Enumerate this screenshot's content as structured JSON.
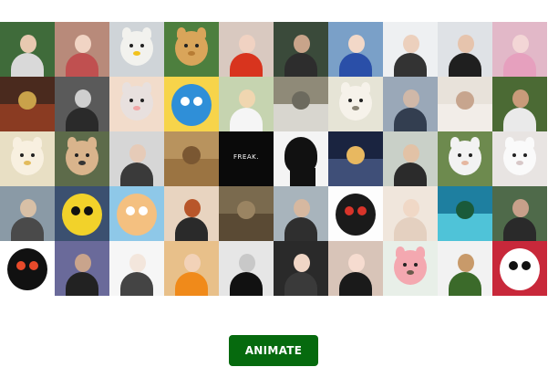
{
  "button": {
    "label": "ANIMATE",
    "color": "#066a0e"
  },
  "tiles": [
    {
      "bg": "#3f6b3a",
      "kind": "person",
      "skin": "#e8c9b0",
      "cloth": "#d9d9d9"
    },
    {
      "bg": "#b88a7a",
      "kind": "person",
      "skin": "#f1d4c4",
      "cloth": "#c05050"
    },
    {
      "bg": "#cfd4d8",
      "kind": "animal",
      "fur": "#f2f2ee",
      "accent": "#f2c21c"
    },
    {
      "bg": "#4d7f3e",
      "kind": "animal",
      "fur": "#d9a55a",
      "accent": "#b77c34"
    },
    {
      "bg": "#d9c9c0",
      "kind": "person",
      "skin": "#f0d2c2",
      "cloth": "#d8341e"
    },
    {
      "bg": "#3a4a3a",
      "kind": "person",
      "skin": "#c8a48a",
      "cloth": "#2d2d2d"
    },
    {
      "bg": "#7aa0c8",
      "kind": "person",
      "skin": "#f2d8c8",
      "cloth": "#2a4fa8"
    },
    {
      "bg": "#eef0f2",
      "kind": "person",
      "skin": "#ecd0bd",
      "cloth": "#333333"
    },
    {
      "bg": "#dfe2e6",
      "kind": "person",
      "skin": "#e6c4ad",
      "cloth": "#1f1f1f"
    },
    {
      "bg": "#e2b8c8",
      "kind": "person",
      "skin": "#f3d6d6",
      "cloth": "#e6a0be"
    },
    {
      "bg": "#4a2a1e",
      "kind": "blob",
      "fur": "#8a3b22",
      "accent": "#c9a24a"
    },
    {
      "bg": "#5a5a5a",
      "kind": "person",
      "skin": "#cfcfcf",
      "cloth": "#2a2a2a"
    },
    {
      "bg": "#f2dccb",
      "kind": "animal",
      "fur": "#e8e0de",
      "accent": "#f0a6a6"
    },
    {
      "bg": "#f7d44a",
      "kind": "cartoon",
      "fur": "#2f8fd8",
      "accent": "#ffffff"
    },
    {
      "bg": "#c6d4b0",
      "kind": "person",
      "skin": "#f0d6b0",
      "cloth": "#f5f5f5"
    },
    {
      "bg": "#8f8a78",
      "kind": "blob",
      "fur": "#d8d6cf",
      "accent": "#6c6a5e"
    },
    {
      "bg": "#e6e4d6",
      "kind": "animal",
      "fur": "#f6f2ea",
      "accent": "#8a8474"
    },
    {
      "bg": "#9aa8b8",
      "kind": "person",
      "skin": "#d0b8a8",
      "cloth": "#333e50"
    },
    {
      "bg": "#e8e2da",
      "kind": "blob",
      "fur": "#f2ede8",
      "accent": "#c7a58e"
    },
    {
      "bg": "#4b6a34",
      "kind": "person",
      "skin": "#c99b7a",
      "cloth": "#eaeaea"
    },
    {
      "bg": "#e8dfc4",
      "kind": "animal",
      "fur": "#f8f0e0",
      "accent": "#e2bb5c"
    },
    {
      "bg": "#5d6b4a",
      "kind": "animal",
      "fur": "#d9b48c",
      "accent": "#343434"
    },
    {
      "bg": "#d6d6d6",
      "kind": "person",
      "skin": "#e6cbb8",
      "cloth": "#3a3a3a"
    },
    {
      "bg": "#b8935e",
      "kind": "blob",
      "fur": "#9b7442",
      "accent": "#7a5732"
    },
    {
      "bg": "#0a0a0a",
      "kind": "text",
      "text": "FREAK.",
      "accent": "#ffffff"
    },
    {
      "bg": "#f4f4f4",
      "kind": "silhouette",
      "fur": "#111111"
    },
    {
      "bg": "#1a2440",
      "kind": "blob",
      "fur": "#3f4f78",
      "accent": "#e8b860"
    },
    {
      "bg": "#c9d0c8",
      "kind": "person",
      "skin": "#e2c2a6",
      "cloth": "#2b2b2b"
    },
    {
      "bg": "#6d8a4e",
      "kind": "animal",
      "fur": "#f2f2f2",
      "accent": "#e5b7a0"
    },
    {
      "bg": "#e8e4e2",
      "kind": "animal",
      "fur": "#fafafa",
      "accent": "#d8c8c8"
    },
    {
      "bg": "#8a9aa6",
      "kind": "person",
      "skin": "#d8c0a6",
      "cloth": "#4a4a4a"
    },
    {
      "bg": "#3b5070",
      "kind": "cartoon",
      "fur": "#f2d22a",
      "accent": "#111111"
    },
    {
      "bg": "#8ec8e8",
      "kind": "cartoon",
      "fur": "#f4c080",
      "accent": "#ffffff"
    },
    {
      "bg": "#e8d4c0",
      "kind": "person",
      "skin": "#b8562a",
      "cloth": "#2a2a2a"
    },
    {
      "bg": "#7a6a4e",
      "kind": "blob",
      "fur": "#5a4a34",
      "accent": "#9a8462"
    },
    {
      "bg": "#a8b4bc",
      "kind": "person",
      "skin": "#d6b8a0",
      "cloth": "#2f2f2f"
    },
    {
      "bg": "#fdfdfd",
      "kind": "cartoon",
      "fur": "#1a1a1a",
      "accent": "#d8342a"
    },
    {
      "bg": "#f0e6dc",
      "kind": "person",
      "skin": "#f0d8c6",
      "cloth": "#e4d0c0"
    },
    {
      "bg": "#1e7fa0",
      "kind": "blob",
      "fur": "#4fc3d8",
      "accent": "#1a5a3a"
    },
    {
      "bg": "#4f6a4a",
      "kind": "person",
      "skin": "#c8a08a",
      "cloth": "#2a2a2a"
    },
    {
      "bg": "#ffffff",
      "kind": "cartoon",
      "fur": "#111111",
      "accent": "#e84a2a"
    },
    {
      "bg": "#6a6a9a",
      "kind": "person",
      "skin": "#c9a48c",
      "cloth": "#222222"
    },
    {
      "bg": "#f6f6f6",
      "kind": "person",
      "skin": "#f3e6dc",
      "cloth": "#444444"
    },
    {
      "bg": "#e8c08a",
      "kind": "person",
      "skin": "#f2d2b8",
      "cloth": "#f08a1a"
    },
    {
      "bg": "#e6e6e6",
      "kind": "person",
      "skin": "#c8c8c8",
      "cloth": "#111111"
    },
    {
      "bg": "#2a2a2a",
      "kind": "person",
      "skin": "#f0d6c6",
      "cloth": "#3a3a3a"
    },
    {
      "bg": "#d8c4b8",
      "kind": "person",
      "skin": "#f6dcd0",
      "cloth": "#1a1a1a"
    },
    {
      "bg": "#e8efe8",
      "kind": "animal",
      "fur": "#f4a8b0",
      "accent": "#6a5a4a"
    },
    {
      "bg": "#f2f2f2",
      "kind": "person",
      "skin": "#c89a6a",
      "cloth": "#3b6a2a"
    },
    {
      "bg": "#c8283a",
      "kind": "cartoon",
      "fur": "#ffffff",
      "accent": "#111111"
    }
  ]
}
